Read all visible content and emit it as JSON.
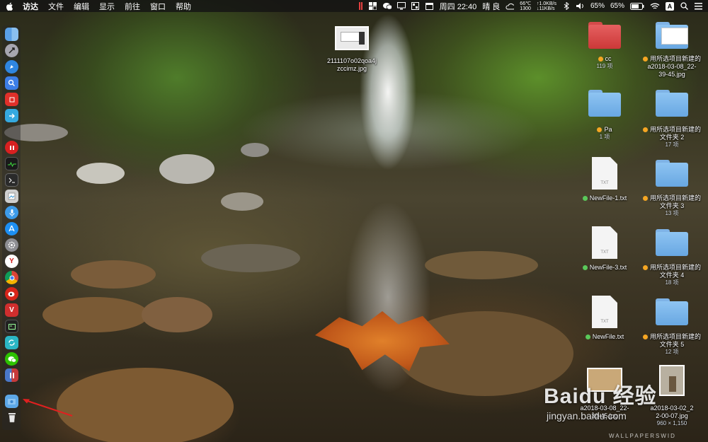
{
  "menubar": {
    "apple_icon": "apple-icon",
    "app_name": "访达",
    "menus": [
      "文件",
      "编辑",
      "显示",
      "前往",
      "窗口",
      "帮助"
    ],
    "status": {
      "cpu_temp": "66℃",
      "cpu_freq": "1300",
      "net_up": "↑1.0KB/s",
      "net_down": "↓11KB/s",
      "datetime": "周四 22:40",
      "weather": "晴 良",
      "battery_a": "65%",
      "battery_b": "65%",
      "input_method": "A"
    }
  },
  "desktop": {
    "items": [
      {
        "id": "screenshot-file",
        "name": "2111107o02qoa4j",
        "name2": "zccimz.jpg",
        "type": "image"
      },
      {
        "id": "folder-cc",
        "name": "cc",
        "sub": "119 项",
        "tag_color": "#f5a623",
        "type": "folder-red"
      },
      {
        "id": "folder-new-1",
        "name": "用所选项目新建的",
        "name2": "a2018-03-08_22-",
        "name3": "39-45.jpg",
        "tag_color": "#f5a623",
        "type": "folder-doc"
      },
      {
        "id": "folder-pa",
        "name": "Pa",
        "sub": "1 项",
        "tag_color": "#f5a623",
        "type": "folder-blue"
      },
      {
        "id": "folder-new-2",
        "name": "用所选项目新建的",
        "name2": "文件夹 2",
        "sub": "17 项",
        "tag_color": "#f5a623",
        "type": "folder-blue"
      },
      {
        "id": "newfile-1",
        "name": "NewFile-1.txt",
        "tag_color": "#5ac85a",
        "type": "txt"
      },
      {
        "id": "folder-new-3",
        "name": "用所选项目新建的",
        "name2": "文件夹 3",
        "sub": "13 项",
        "tag_color": "#f5a623",
        "type": "folder-blue"
      },
      {
        "id": "newfile-3",
        "name": "NewFile-3.txt",
        "tag_color": "#5ac85a",
        "type": "txt"
      },
      {
        "id": "folder-new-4",
        "name": "用所选项目新建的",
        "name2": "文件夹 4",
        "sub": "18 项",
        "tag_color": "#f5a623",
        "type": "folder-blue"
      },
      {
        "id": "newfile",
        "name": "NewFile.txt",
        "tag_color": "#5ac85a",
        "type": "txt"
      },
      {
        "id": "folder-new-5",
        "name": "用所选项目新建的",
        "name2": "文件夹 5",
        "sub": "12 项",
        "tag_color": "#f5a623",
        "type": "folder-blue"
      },
      {
        "id": "image-a",
        "name": "a2018-03-08_22-",
        "name2": "39-45.jpg",
        "type": "image"
      },
      {
        "id": "image-b",
        "name": "a2018-03-02_2",
        "name2": "2-00-07.jpg",
        "sub": "960 × 1,150",
        "type": "image"
      }
    ],
    "txt_ext": "TXT"
  },
  "watermark": {
    "brand": "Baidu 经验",
    "url": "jingyan.baidu.com",
    "wallpaper": "WALLPAPERSWID"
  },
  "colors": {
    "menubar_bg": "#141414",
    "folder_blue": "#7fb3e6",
    "folder_red": "#d44a4a",
    "tag_orange": "#f5a623",
    "tag_green": "#5ac85a",
    "arrow_red": "#e02020"
  }
}
